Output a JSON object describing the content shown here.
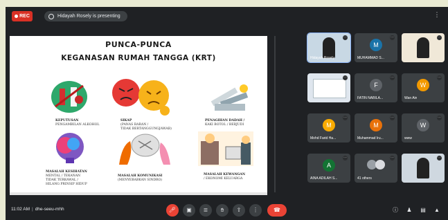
{
  "topbar": {
    "rec_label": "REC",
    "presenting_text": "Hidayah Rosely is presenting"
  },
  "slide": {
    "title_line1": "PUNCA-PUNCA",
    "title_line2": "KEGANASAN RUMAH TANGGA (KRT)",
    "captions": [
      {
        "line1": "KEPUTUSAN",
        "line2": "PENGAMBILAN ALKOHOL"
      },
      {
        "line1": "SIKAP",
        "line2": "(PANAS BARAN /",
        "line3": "TIDAK BERTANGGUNGJAWAB)"
      },
      {
        "line1": "PENAGIHAN DADAH /",
        "line2": "KAKI BOTOL / BERJUDI"
      },
      {
        "line1": "MASALAH KESIHATAN",
        "line2": "MENTAL / TEKANAN",
        "line3": "TIDAK TERKAWAL /",
        "line4": "HILANG PRINSIP HIDUP"
      },
      {
        "line1": "MASALAH KOMUNIKASI",
        "line2": "(MENYEBABKAN SINDRO)"
      },
      {
        "line1": "MASALAH KEWANGAN",
        "line2": "/ EKONOMI KELUARGA"
      }
    ]
  },
  "participants": [
    {
      "name": "Hidayah Rosely",
      "initial": "",
      "color": "#c8d8e4",
      "kind": "camera"
    },
    {
      "name": "MUHAMMAD S...",
      "initial": "M",
      "color": "#1a73a8",
      "kind": "avatar"
    },
    {
      "name": "",
      "initial": "",
      "color": "#f0e8d8",
      "kind": "camera"
    },
    {
      "name": "",
      "initial": "",
      "color": "#dfe6ee",
      "kind": "screen"
    },
    {
      "name": "FATIN NABILA...",
      "initial": "F",
      "color": "#5f6368",
      "kind": "avatar"
    },
    {
      "name": "Wan Ain",
      "initial": "W",
      "color": "#f29900",
      "kind": "avatar"
    },
    {
      "name": "Mohd Farid Ha...",
      "initial": "M",
      "color": "#f9ab00",
      "kind": "avatar"
    },
    {
      "name": "Muhammad Iru...",
      "initial": "M",
      "color": "#e8710a",
      "kind": "avatar"
    },
    {
      "name": "www",
      "initial": "W",
      "color": "#5f6368",
      "kind": "avatar"
    },
    {
      "name": "AINA ADILAH S...",
      "initial": "A",
      "color": "#137333",
      "kind": "avatar"
    },
    {
      "name": "41 others",
      "initial": "",
      "color": "#3c4043",
      "kind": "others"
    },
    {
      "name": "",
      "initial": "",
      "color": "#cfd8e0",
      "kind": "camera"
    }
  ],
  "bottombar": {
    "time": "11:02 AM",
    "separator": "|",
    "meeting_code": "dhe-seeu-mhh"
  },
  "colors": {
    "accent_red": "#ea4335",
    "panel": "#3c4043",
    "background": "#1f2124"
  }
}
